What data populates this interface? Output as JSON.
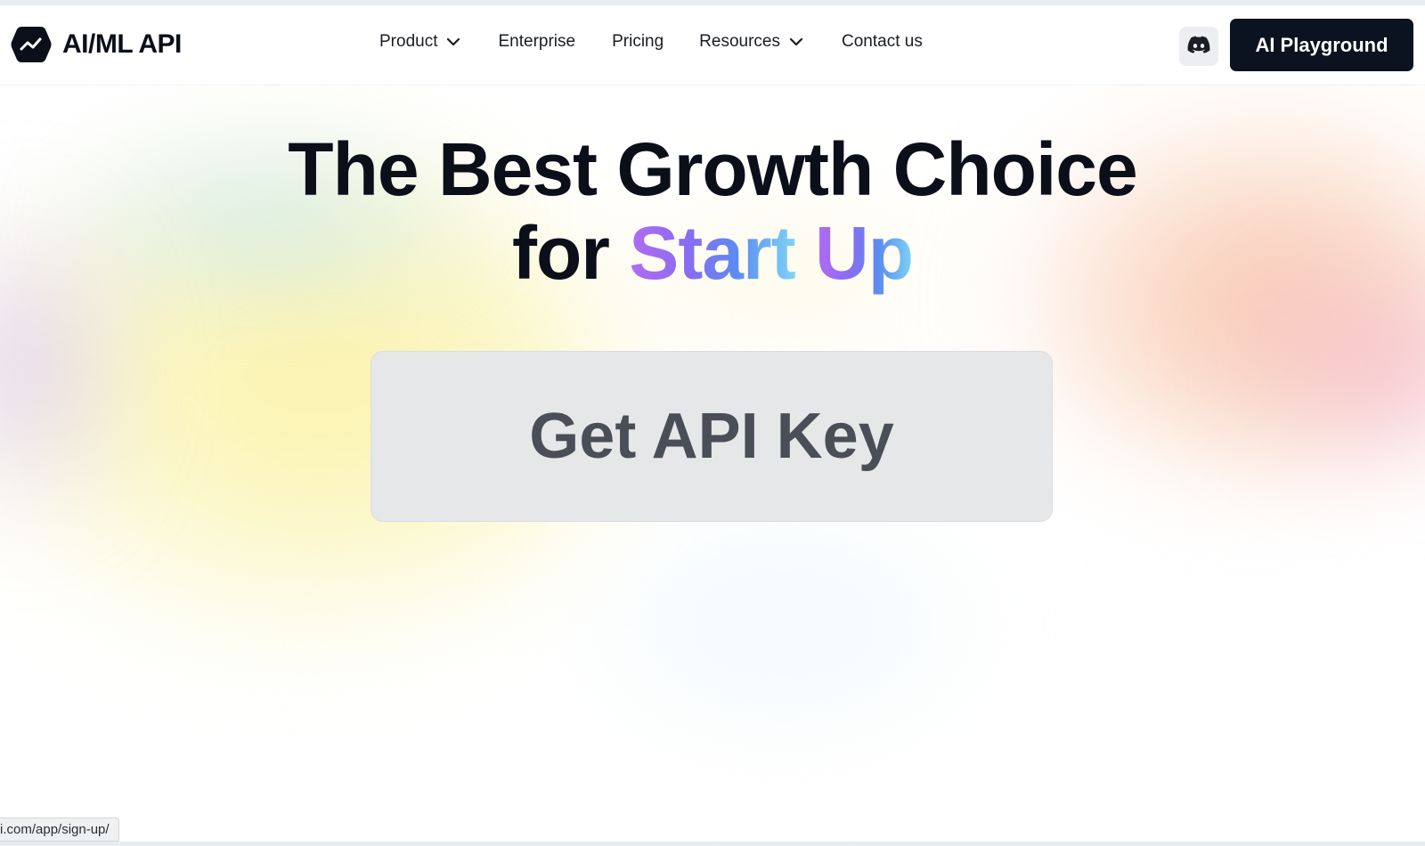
{
  "brand": {
    "name": "AI/ML API",
    "logo_icon": "chart-hexagon-icon"
  },
  "nav": {
    "product": "Product",
    "enterprise": "Enterprise",
    "pricing": "Pricing",
    "resources": "Resources",
    "contact": "Contact us"
  },
  "header": {
    "discord_icon": "discord-icon",
    "playground_label": "AI Playground"
  },
  "hero": {
    "line1": "The Best Growth Choice",
    "line2_prefix": "for ",
    "line2_highlight_1": "Start",
    "line2_space": " ",
    "line2_highlight_2": "Up",
    "cta_label": "Get API Key"
  },
  "status_url": "i.com/app/sign-up/",
  "colors": {
    "primary_dark": "#0b1220",
    "cta_bg": "#e6e7e9",
    "cta_text": "#4a4f57",
    "gradient_start": "#b26cf0",
    "gradient_end": "#7fd3f5"
  }
}
